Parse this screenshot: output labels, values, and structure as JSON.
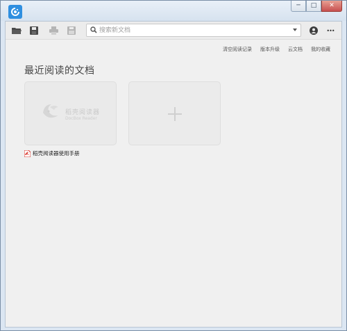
{
  "window": {
    "controls": {
      "minimize": "─",
      "maximize": "□",
      "close": "✕"
    }
  },
  "toolbar": {
    "icons": [
      "open-folder-icon",
      "save-icon",
      "print-icon",
      "save-as-icon",
      "account-icon",
      "more-icon"
    ],
    "more_label": "•••"
  },
  "search": {
    "placeholder": "搜索新文档",
    "value": ""
  },
  "links": {
    "clear_history": "清空阅读记录",
    "version_upgrade": "版本升级",
    "cloud_docs": "云文档",
    "my_favorites": "我的收藏"
  },
  "main": {
    "title": "最近阅读的文档",
    "recent_docs": [
      {
        "brand_name": "稻壳阅读器",
        "brand_sub": "DocBox Reader",
        "file_name": "稻壳阅读器使用手册",
        "file_type_icon": "pdf-icon"
      }
    ],
    "add_card_label": "+"
  },
  "colors": {
    "accent": "#2f8fe0",
    "pdf_red": "#d9342b"
  }
}
